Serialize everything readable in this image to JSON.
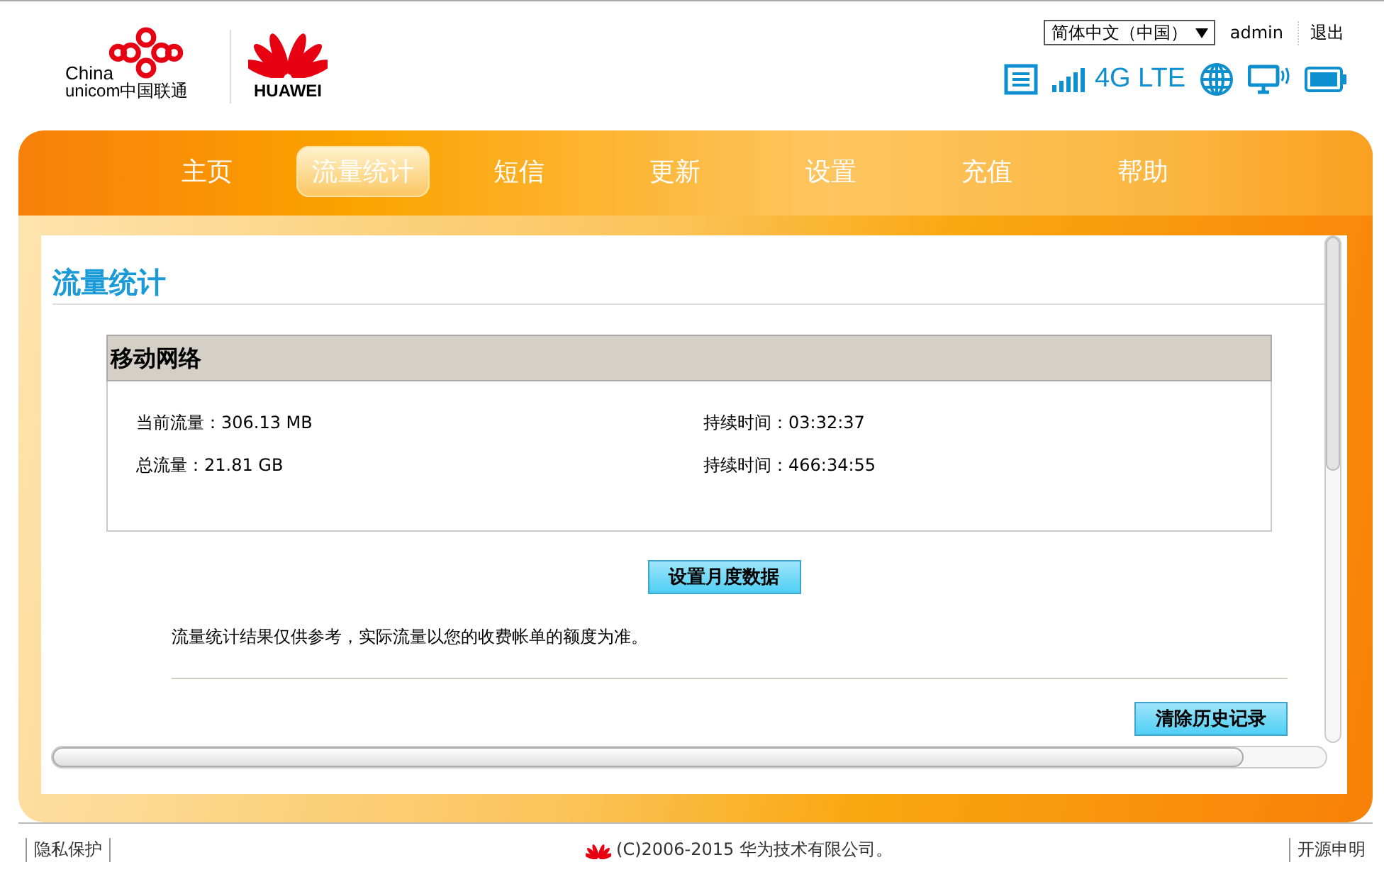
{
  "header": {
    "logo_line_1": "China",
    "logo_line_2": "unicom中国联通",
    "brand": "HUAWEI",
    "language": "简体中文（中国）",
    "user": "admin",
    "logout": "退出",
    "network_type": "4G LTE"
  },
  "nav": [
    {
      "label": "主页",
      "selected": false
    },
    {
      "label": "流量统计",
      "selected": true
    },
    {
      "label": "短信",
      "selected": false
    },
    {
      "label": "更新",
      "selected": false
    },
    {
      "label": "设置",
      "selected": false
    },
    {
      "label": "充值",
      "selected": false
    },
    {
      "label": "帮助",
      "selected": false
    }
  ],
  "page_title": "流量统计",
  "section": {
    "title": "移动网络",
    "rows": [
      {
        "left": "当前流量：306.13 MB",
        "right": "持续时间：03:32:37"
      },
      {
        "left": "总流量：21.81 GB",
        "right": "持续时间：466:34:55"
      }
    ]
  },
  "monthly_button": "设置月度数据",
  "note": "流量统计结果仅供参考，实际流量以您的收费帐单的额度为准。",
  "clear_button": "清除历史记录",
  "footer": {
    "privacy": "隐私保护",
    "copyright": "(C)2006-2015 华为技术有限公司。",
    "open_source": "开源申明"
  }
}
